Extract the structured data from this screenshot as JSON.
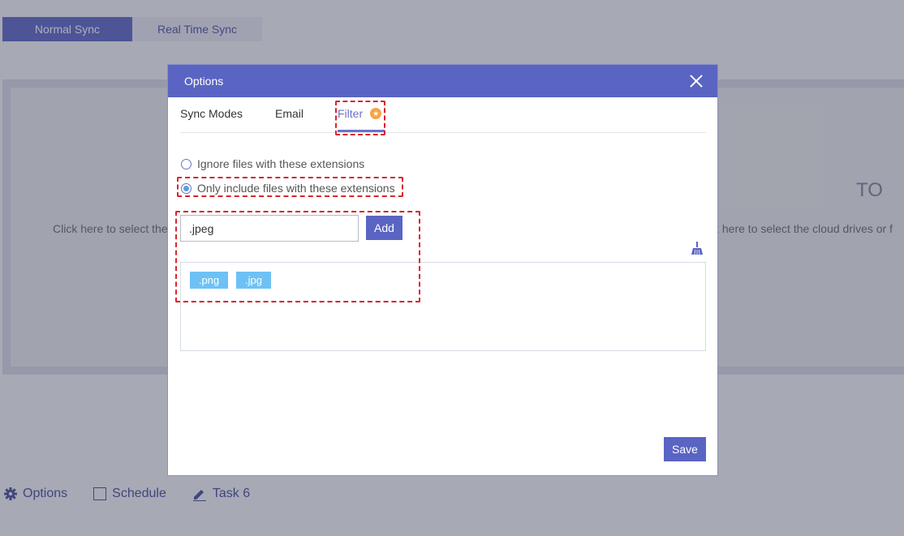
{
  "sync_tabs": {
    "normal": "Normal Sync",
    "realtime": "Real Time Sync"
  },
  "workspace": {
    "left_hint": "Click here to select the",
    "right_hint": "ck here to select the cloud drives or f",
    "to_label": "TO"
  },
  "bottom_bar": {
    "options": "Options",
    "schedule": "Schedule",
    "task": "Task 6"
  },
  "dialog": {
    "title": "Options",
    "tabs": {
      "sync_modes": "Sync Modes",
      "email": "Email",
      "filter": "Filter"
    },
    "filter": {
      "ignore_label": "Ignore files with these extensions",
      "include_label": "Only include files with these extensions",
      "selected_mode": "include",
      "input_value": ".jpeg",
      "add_label": "Add",
      "extensions": [
        ".png",
        ".jpg"
      ]
    },
    "save_label": "Save"
  },
  "colors": {
    "accent": "#5a64c3",
    "tag": "#6ec1f5",
    "highlight": "#d9242d",
    "badge": "#f3a54a"
  }
}
